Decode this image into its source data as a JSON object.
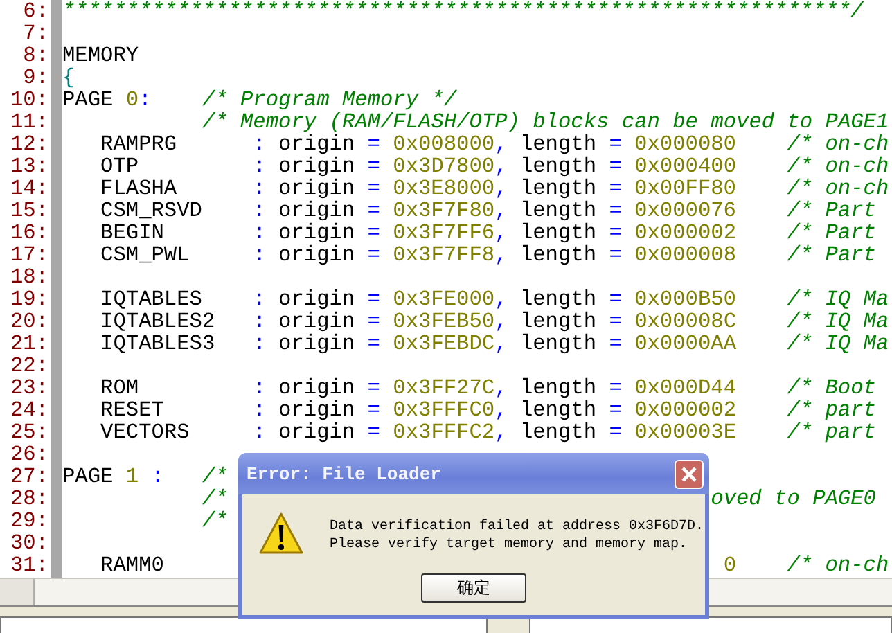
{
  "editor": {
    "lines": [
      {
        "number": "6:",
        "kind": "plain",
        "tokens": [
          {
            "kind": "comment",
            "text": "**************************************************************/"
          }
        ]
      },
      {
        "number": "7:",
        "kind": "plain"
      },
      {
        "number": "8:",
        "kind": "plain",
        "tokens": [
          {
            "kind": "plain",
            "text": "MEMORY"
          }
        ]
      },
      {
        "number": "9:",
        "kind": "plain",
        "tokens": [
          {
            "kind": "brace",
            "text": "{"
          }
        ]
      },
      {
        "number": "10:",
        "kind": "page",
        "tokens": [
          {
            "kind": "plain",
            "text": "PAGE"
          },
          {
            "kind": "number",
            "text": "0"
          },
          {
            "kind": "operator",
            "text": ":"
          },
          {
            "kind": "comment",
            "text": "/* Program Memory */"
          }
        ]
      },
      {
        "number": "11:",
        "kind": "comment",
        "tokens": [
          {
            "kind": "comment",
            "text": "/* Memory (RAM/FLASH/OTP) blocks can be moved to PAGE1"
          }
        ]
      },
      {
        "number": "12:",
        "kind": "entry",
        "tokens": [
          {
            "kind": "plain",
            "text": "RAMPRG"
          },
          {
            "kind": "operator",
            "text": ":"
          },
          {
            "kind": "plain",
            "text": "origin"
          },
          {
            "kind": "operator",
            "text": "="
          },
          {
            "kind": "number",
            "text": "0x008000"
          },
          {
            "kind": "operator",
            "text": ","
          },
          {
            "kind": "plain",
            "text": "length"
          },
          {
            "kind": "operator",
            "text": "="
          },
          {
            "kind": "number",
            "text": "0x000080"
          },
          {
            "kind": "comment",
            "text": "/* on-ch"
          }
        ]
      },
      {
        "number": "13:",
        "kind": "entry",
        "tokens": [
          {
            "kind": "plain",
            "text": "OTP"
          },
          {
            "kind": "operator",
            "text": ":"
          },
          {
            "kind": "plain",
            "text": "origin"
          },
          {
            "kind": "operator",
            "text": "="
          },
          {
            "kind": "number",
            "text": "0x3D7800"
          },
          {
            "kind": "operator",
            "text": ","
          },
          {
            "kind": "plain",
            "text": "length"
          },
          {
            "kind": "operator",
            "text": "="
          },
          {
            "kind": "number",
            "text": "0x000400"
          },
          {
            "kind": "comment",
            "text": "/* on-ch"
          }
        ]
      },
      {
        "number": "14:",
        "kind": "entry",
        "tokens": [
          {
            "kind": "plain",
            "text": "FLASHA"
          },
          {
            "kind": "operator",
            "text": ":"
          },
          {
            "kind": "plain",
            "text": "origin"
          },
          {
            "kind": "operator",
            "text": "="
          },
          {
            "kind": "number",
            "text": "0x3E8000"
          },
          {
            "kind": "operator",
            "text": ","
          },
          {
            "kind": "plain",
            "text": "length"
          },
          {
            "kind": "operator",
            "text": "="
          },
          {
            "kind": "number",
            "text": "0x00FF80"
          },
          {
            "kind": "comment",
            "text": "/* on-ch"
          }
        ]
      },
      {
        "number": "15:",
        "kind": "entry",
        "tokens": [
          {
            "kind": "plain",
            "text": "CSM_RSVD"
          },
          {
            "kind": "operator",
            "text": ":"
          },
          {
            "kind": "plain",
            "text": "origin"
          },
          {
            "kind": "operator",
            "text": "="
          },
          {
            "kind": "number",
            "text": "0x3F7F80"
          },
          {
            "kind": "operator",
            "text": ","
          },
          {
            "kind": "plain",
            "text": "length"
          },
          {
            "kind": "operator",
            "text": "="
          },
          {
            "kind": "number",
            "text": "0x000076"
          },
          {
            "kind": "comment",
            "text": "/* Part"
          }
        ]
      },
      {
        "number": "16:",
        "kind": "entry",
        "tokens": [
          {
            "kind": "plain",
            "text": "BEGIN"
          },
          {
            "kind": "operator",
            "text": ":"
          },
          {
            "kind": "plain",
            "text": "origin"
          },
          {
            "kind": "operator",
            "text": "="
          },
          {
            "kind": "number",
            "text": "0x3F7FF6"
          },
          {
            "kind": "operator",
            "text": ","
          },
          {
            "kind": "plain",
            "text": "length"
          },
          {
            "kind": "operator",
            "text": "="
          },
          {
            "kind": "number",
            "text": "0x000002"
          },
          {
            "kind": "comment",
            "text": "/* Part"
          }
        ]
      },
      {
        "number": "17:",
        "kind": "entry",
        "tokens": [
          {
            "kind": "plain",
            "text": "CSM_PWL"
          },
          {
            "kind": "operator",
            "text": ":"
          },
          {
            "kind": "plain",
            "text": "origin"
          },
          {
            "kind": "operator",
            "text": "="
          },
          {
            "kind": "number",
            "text": "0x3F7FF8"
          },
          {
            "kind": "operator",
            "text": ","
          },
          {
            "kind": "plain",
            "text": "length"
          },
          {
            "kind": "operator",
            "text": "="
          },
          {
            "kind": "number",
            "text": "0x000008"
          },
          {
            "kind": "comment",
            "text": "/* Part"
          }
        ]
      },
      {
        "number": "18:",
        "kind": "plain"
      },
      {
        "number": "19:",
        "kind": "entry",
        "tokens": [
          {
            "kind": "plain",
            "text": "IQTABLES"
          },
          {
            "kind": "operator",
            "text": ":"
          },
          {
            "kind": "plain",
            "text": "origin"
          },
          {
            "kind": "operator",
            "text": "="
          },
          {
            "kind": "number",
            "text": "0x3FE000"
          },
          {
            "kind": "operator",
            "text": ","
          },
          {
            "kind": "plain",
            "text": "length"
          },
          {
            "kind": "operator",
            "text": "="
          },
          {
            "kind": "number",
            "text": "0x000B50"
          },
          {
            "kind": "comment",
            "text": "/* IQ Ma"
          }
        ]
      },
      {
        "number": "20:",
        "kind": "entry",
        "tokens": [
          {
            "kind": "plain",
            "text": "IQTABLES2"
          },
          {
            "kind": "operator",
            "text": ":"
          },
          {
            "kind": "plain",
            "text": "origin"
          },
          {
            "kind": "operator",
            "text": "="
          },
          {
            "kind": "number",
            "text": "0x3FEB50"
          },
          {
            "kind": "operator",
            "text": ","
          },
          {
            "kind": "plain",
            "text": "length"
          },
          {
            "kind": "operator",
            "text": "="
          },
          {
            "kind": "number",
            "text": "0x00008C"
          },
          {
            "kind": "comment",
            "text": "/* IQ Ma"
          }
        ]
      },
      {
        "number": "21:",
        "kind": "entry",
        "tokens": [
          {
            "kind": "plain",
            "text": "IQTABLES3"
          },
          {
            "kind": "operator",
            "text": ":"
          },
          {
            "kind": "plain",
            "text": "origin"
          },
          {
            "kind": "operator",
            "text": "="
          },
          {
            "kind": "number",
            "text": "0x3FEBDC"
          },
          {
            "kind": "operator",
            "text": ","
          },
          {
            "kind": "plain",
            "text": "length"
          },
          {
            "kind": "operator",
            "text": "="
          },
          {
            "kind": "number",
            "text": "0x0000AA"
          },
          {
            "kind": "comment",
            "text": "/* IQ Ma"
          }
        ]
      },
      {
        "number": "22:",
        "kind": "plain"
      },
      {
        "number": "23:",
        "kind": "entry",
        "tokens": [
          {
            "kind": "plain",
            "text": "ROM"
          },
          {
            "kind": "operator",
            "text": ":"
          },
          {
            "kind": "plain",
            "text": "origin"
          },
          {
            "kind": "operator",
            "text": "="
          },
          {
            "kind": "number",
            "text": "0x3FF27C"
          },
          {
            "kind": "operator",
            "text": ","
          },
          {
            "kind": "plain",
            "text": "length"
          },
          {
            "kind": "operator",
            "text": "="
          },
          {
            "kind": "number",
            "text": "0x000D44"
          },
          {
            "kind": "comment",
            "text": "/* Boot"
          }
        ]
      },
      {
        "number": "24:",
        "kind": "entry",
        "tokens": [
          {
            "kind": "plain",
            "text": "RESET"
          },
          {
            "kind": "operator",
            "text": ":"
          },
          {
            "kind": "plain",
            "text": "origin"
          },
          {
            "kind": "operator",
            "text": "="
          },
          {
            "kind": "number",
            "text": "0x3FFFC0"
          },
          {
            "kind": "operator",
            "text": ","
          },
          {
            "kind": "plain",
            "text": "length"
          },
          {
            "kind": "operator",
            "text": "="
          },
          {
            "kind": "number",
            "text": "0x000002"
          },
          {
            "kind": "comment",
            "text": "/* part"
          }
        ]
      },
      {
        "number": "25:",
        "kind": "entry",
        "tokens": [
          {
            "kind": "plain",
            "text": "VECTORS"
          },
          {
            "kind": "operator",
            "text": ":"
          },
          {
            "kind": "plain",
            "text": "origin"
          },
          {
            "kind": "operator",
            "text": "="
          },
          {
            "kind": "number",
            "text": "0x3FFFC2"
          },
          {
            "kind": "operator",
            "text": ","
          },
          {
            "kind": "plain",
            "text": "length"
          },
          {
            "kind": "operator",
            "text": "="
          },
          {
            "kind": "number",
            "text": "0x00003E"
          },
          {
            "kind": "comment",
            "text": "/* part"
          }
        ]
      },
      {
        "number": "26:",
        "kind": "plain"
      },
      {
        "number": "27:",
        "kind": "page_spaced",
        "tokens": [
          {
            "kind": "plain",
            "text": "PAGE"
          },
          {
            "kind": "number",
            "text": "1"
          },
          {
            "kind": "operator",
            "text": ":"
          },
          {
            "kind": "comment",
            "text": "/*"
          }
        ]
      },
      {
        "number": "28:",
        "kind": "split_comment",
        "tokens": [
          {
            "kind": "comment",
            "text": "/*"
          },
          {
            "kind": "comment",
            "text": "oved to PAGE0"
          }
        ]
      },
      {
        "number": "29:",
        "kind": "comment",
        "tokens": [
          {
            "kind": "comment",
            "text": "/*"
          }
        ]
      },
      {
        "number": "30:",
        "kind": "plain"
      },
      {
        "number": "31:",
        "kind": "partial_entry",
        "tokens": [
          {
            "kind": "plain",
            "text": "RAMM0"
          },
          {
            "kind": "number",
            "text": "0"
          },
          {
            "kind": "comment",
            "text": "/* on-ch"
          }
        ]
      }
    ]
  },
  "dialog": {
    "title": "Error: File Loader",
    "message": [
      "Data verification failed at address 0x3F6D7D.",
      "Please verify target memory and memory map."
    ],
    "button": "确定"
  }
}
